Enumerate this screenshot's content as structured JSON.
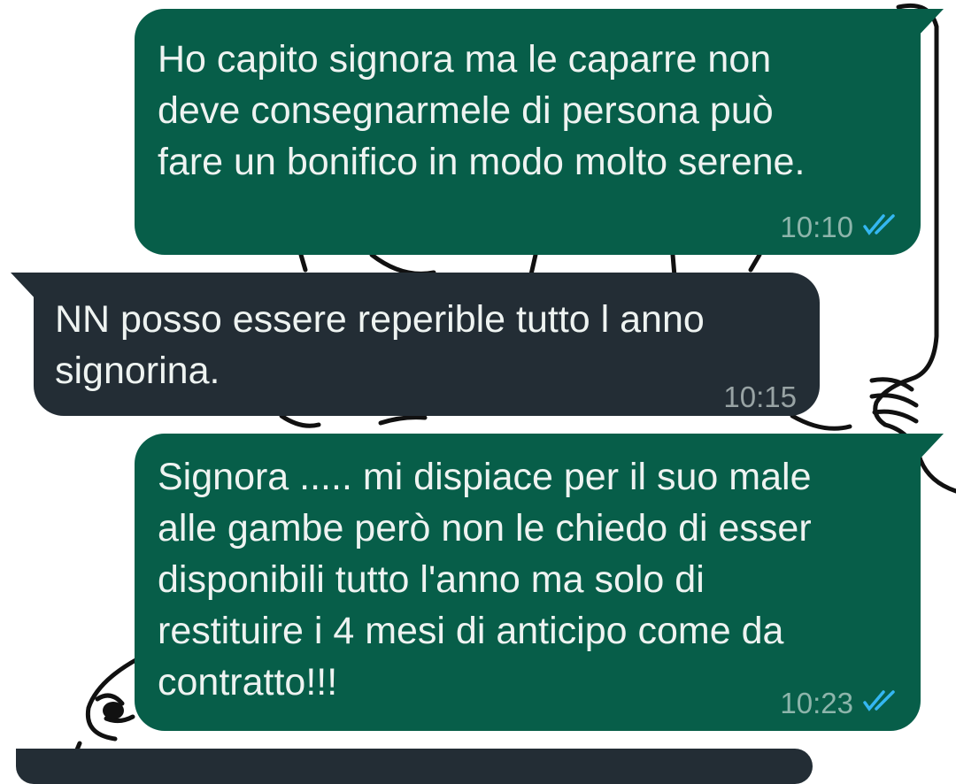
{
  "colors": {
    "outgoing_bubble": "#075e49",
    "incoming_bubble": "#232d35",
    "message_text": "#eef3f1",
    "read_ticks": "#34b7f1",
    "background": "#ffffff"
  },
  "messages": [
    {
      "direction": "outgoing",
      "text": "Ho capito signora ma le caparre non\ndeve consegnarmele di persona può\nfare un bonifico in modo molto serene.",
      "time": "10:10",
      "status_icon": "double-check-read-icon"
    },
    {
      "direction": "incoming",
      "text": "NN posso essere reperible tutto l anno\nsignorina.",
      "time": "10:15"
    },
    {
      "direction": "outgoing",
      "text": "Signora ..... mi dispiace per il suo male\nalle gambe però non le chiedo di esser\ndisponibili tutto l'anno ma solo di\nrestituire i 4 mesi di anticipo come da\ncontratto!!!",
      "time": "10:23",
      "status_icon": "double-check-read-icon"
    }
  ]
}
